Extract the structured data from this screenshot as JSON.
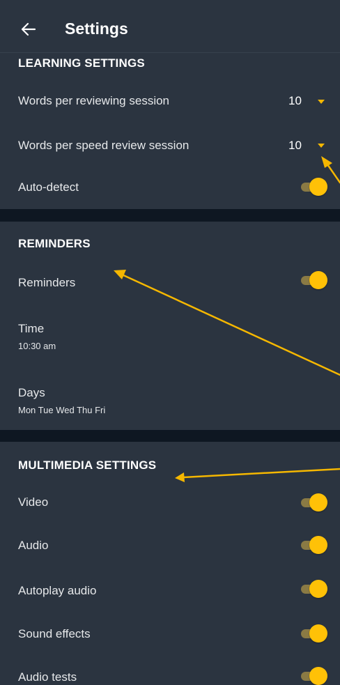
{
  "header": {
    "title": "Settings",
    "back_icon": "arrow-left-icon"
  },
  "learning": {
    "title": "LEARNING SETTINGS",
    "words_review_label": "Words per reviewing session",
    "words_review_value": "10",
    "words_speed_label": "Words per speed review session",
    "words_speed_value": "10",
    "auto_detect_label": "Auto-detect",
    "auto_detect_on": true
  },
  "reminders": {
    "title": "REMINDERS",
    "toggle_label": "Reminders",
    "toggle_on": true,
    "time_label": "Time",
    "time_value": "10:30 am",
    "days_label": "Days",
    "days_value": "Mon Tue Wed Thu Fri"
  },
  "multimedia": {
    "title": "MULTIMEDIA SETTINGS",
    "items": [
      {
        "label": "Video",
        "on": true
      },
      {
        "label": "Audio",
        "on": true
      },
      {
        "label": "Autoplay audio",
        "on": true
      },
      {
        "label": "Sound effects",
        "on": true
      },
      {
        "label": "Audio tests",
        "on": true
      }
    ]
  },
  "colors": {
    "background": "#2b3440",
    "divider": "#0e1722",
    "accent": "#ffc107",
    "annotation_arrow": "#f5b700"
  }
}
